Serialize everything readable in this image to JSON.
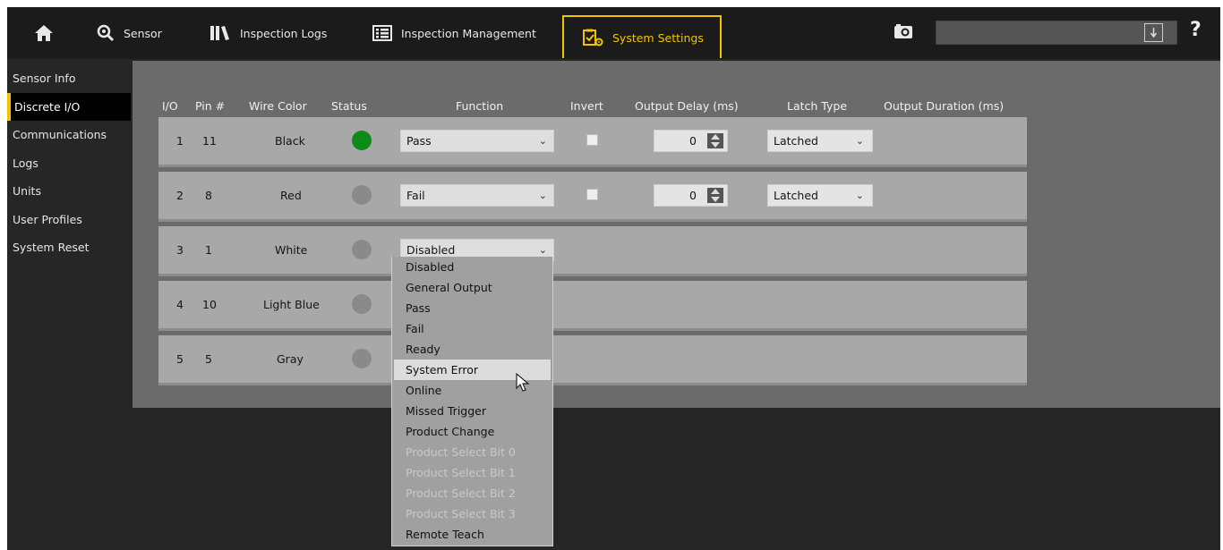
{
  "nav": {
    "sensor": "Sensor",
    "inspection_logs": "Inspection Logs",
    "inspection_management": "Inspection Management",
    "system_settings": "System Settings",
    "active": "system_settings",
    "accent_color": "#f2c400"
  },
  "sidebar": {
    "items": [
      {
        "label": "Sensor Info"
      },
      {
        "label": "Discrete I/O",
        "active": true
      },
      {
        "label": "Communications"
      },
      {
        "label": "Logs"
      },
      {
        "label": "Units"
      },
      {
        "label": "User Profiles"
      },
      {
        "label": "System Reset"
      }
    ]
  },
  "table": {
    "headers": {
      "io": "I/O",
      "pin": "Pin #",
      "wire": "Wire Color",
      "status": "Status",
      "function": "Function",
      "invert": "Invert",
      "delay": "Output Delay (ms)",
      "latch": "Latch Type",
      "duration": "Output Duration (ms)"
    },
    "rows": [
      {
        "io": "1",
        "pin": "11",
        "wire": "Black",
        "status_on": true,
        "function": "Pass",
        "invert": false,
        "delay": "0",
        "latch": "Latched"
      },
      {
        "io": "2",
        "pin": "8",
        "wire": "Red",
        "status_on": false,
        "function": "Fail",
        "invert": false,
        "delay": "0",
        "latch": "Latched"
      },
      {
        "io": "3",
        "pin": "1",
        "wire": "White",
        "status_on": false,
        "function": "Disabled"
      },
      {
        "io": "4",
        "pin": "10",
        "wire": "Light Blue",
        "status_on": false
      },
      {
        "io": "5",
        "pin": "5",
        "wire": "Gray",
        "status_on": false
      }
    ]
  },
  "function_dropdown": {
    "options": [
      {
        "label": "Disabled"
      },
      {
        "label": "General Output"
      },
      {
        "label": "Pass"
      },
      {
        "label": "Fail"
      },
      {
        "label": "Ready"
      },
      {
        "label": "System Error",
        "hovered": true
      },
      {
        "label": "Online"
      },
      {
        "label": "Missed Trigger"
      },
      {
        "label": "Product Change"
      },
      {
        "label": "Product Select Bit 0",
        "disabled": true
      },
      {
        "label": "Product Select Bit 1",
        "disabled": true
      },
      {
        "label": "Product Select Bit 2",
        "disabled": true
      },
      {
        "label": "Product Select Bit 3",
        "disabled": true
      },
      {
        "label": "Remote Teach"
      }
    ]
  },
  "colors": {
    "status_on": "#0c8a1a",
    "status_off": "#8a8a8a"
  }
}
